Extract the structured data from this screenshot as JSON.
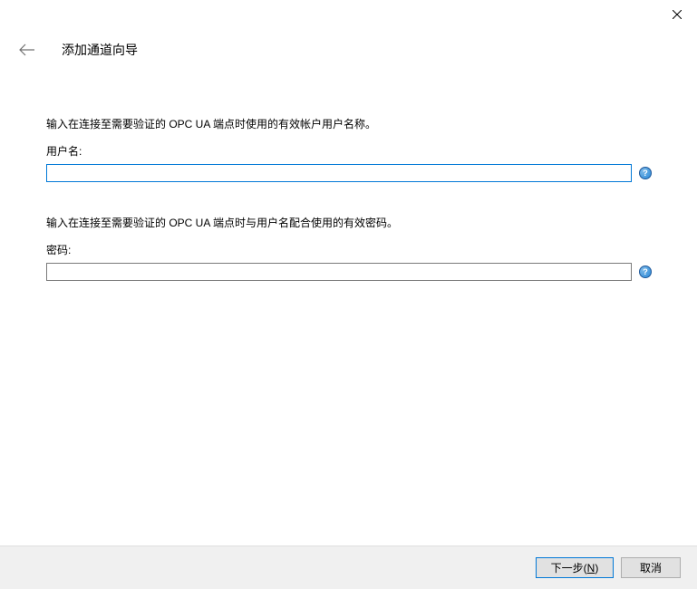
{
  "header": {
    "title": "添加通道向导"
  },
  "fields": {
    "username": {
      "desc": "输入在连接至需要验证的 OPC UA 端点时使用的有效帐户用户名称。",
      "label": "用户名:",
      "value": ""
    },
    "password": {
      "desc": "输入在连接至需要验证的 OPC UA 端点时与用户名配合使用的有效密码。",
      "label": "密码:",
      "value": ""
    }
  },
  "footer": {
    "next_label_prefix": "下一步(",
    "next_accel": "N",
    "next_label_suffix": ")",
    "cancel_label": "取消"
  },
  "help_glyph": "?"
}
